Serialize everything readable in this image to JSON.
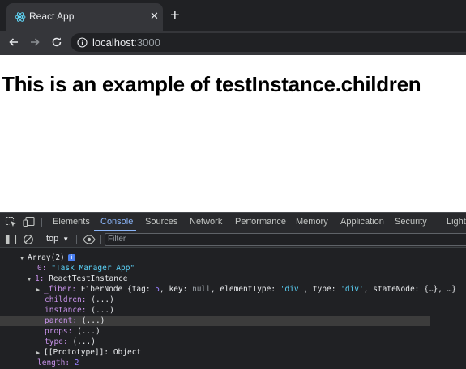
{
  "browser": {
    "tab_title": "React App",
    "tab_close": "✕",
    "new_tab": "+",
    "url_host": "localhost",
    "url_port": ":3000"
  },
  "page": {
    "heading": "This is an example of testInstance.children"
  },
  "devtools": {
    "tabs": [
      "Elements",
      "Console",
      "Sources",
      "Network",
      "Performance",
      "Memory",
      "Application",
      "Security",
      "Lighth"
    ],
    "active_tab": "Console",
    "context": "top",
    "filter_placeholder": "Filter",
    "console": {
      "array_label": "Array(2)",
      "info_badge": "i",
      "item0_key": "0:",
      "item0_value": "\"Task Manager App\"",
      "item1_key": "1:",
      "item1_value": "ReactTestInstance",
      "fiber_key": "_fiber:",
      "fiber_value_a": "FiberNode {tag: ",
      "fiber_tag": "5",
      "fiber_value_b": ", key: ",
      "fiber_key_val": "null",
      "fiber_value_c": ", elementType: ",
      "fiber_elementType": "'div'",
      "fiber_value_d": ", type: ",
      "fiber_type": "'div'",
      "fiber_value_e": ", stateNode: {…}, …}",
      "children_key": "children:",
      "instance_key": "instance:",
      "parent_key": "parent:",
      "props_key": "props:",
      "type_key": "type:",
      "getter_value": "(...)",
      "prototype_key": "[[Prototype]]:",
      "prototype_value": "Object",
      "length_key": "length:",
      "length_value": "2"
    }
  },
  "colors": {
    "chrome_dark": "#202124",
    "chrome_mid": "#35363a",
    "devtools_accent": "#8ab4f8",
    "string_color": "#5cd5fb"
  }
}
